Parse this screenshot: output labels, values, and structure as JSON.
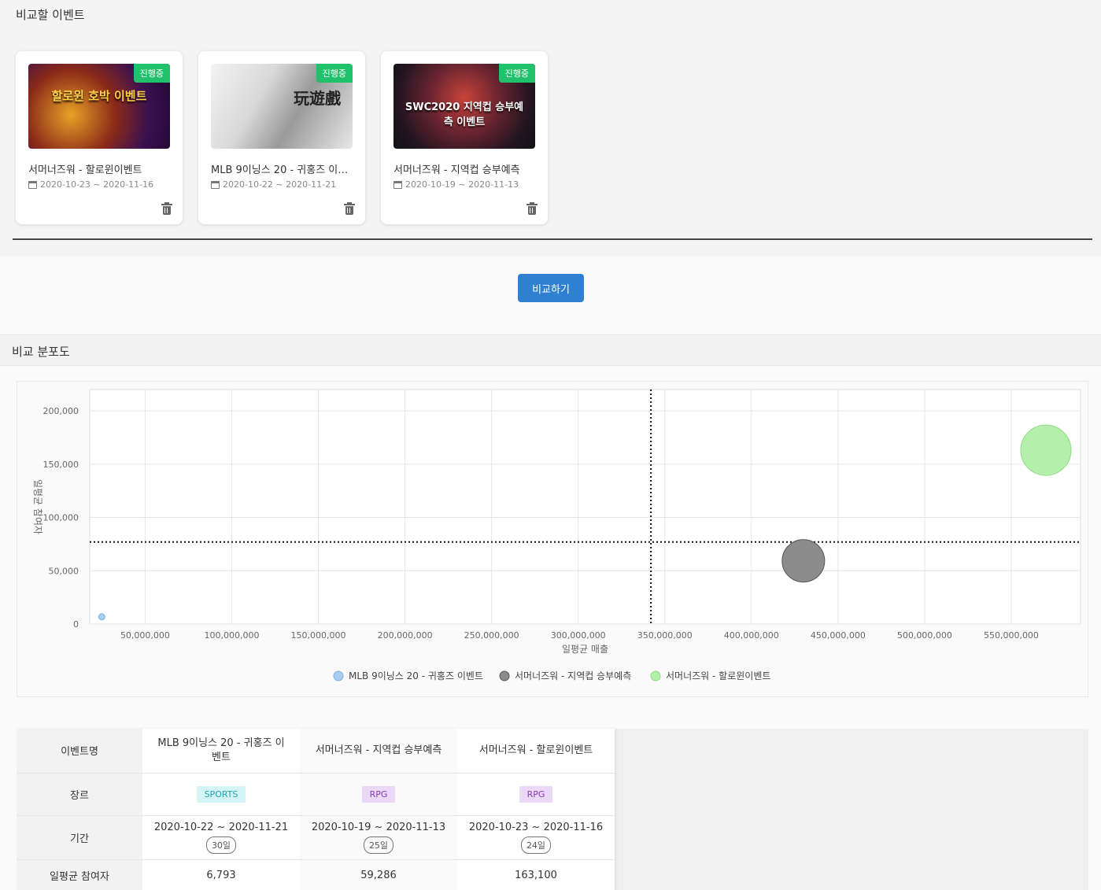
{
  "selection": {
    "title": "비교할 이벤트",
    "cards": [
      {
        "title": "서머너즈워 - 할로윈이벤트",
        "date": "2020-10-23 ~ 2020-11-16",
        "status": "진행중",
        "art_text": "할로윈 호박 이벤트"
      },
      {
        "title": "MLB 9이닝스 20 - 귀홍즈 이벤트",
        "date": "2020-10-22 ~ 2020-11-21",
        "status": "진행중",
        "art_text": "玩遊戲"
      },
      {
        "title": "서머너즈워 - 지역컵 승부예측",
        "date": "2020-10-19 ~ 2020-11-13",
        "status": "진행중",
        "art_text": "SWC2020 지역컵 승부예측 이벤트"
      }
    ]
  },
  "compare_button": "비교하기",
  "scatter": {
    "title": "비교 분포도"
  },
  "chart_data": {
    "type": "scatter",
    "xlabel": "일평균 매출",
    "ylabel": "일평균 참여자",
    "x_ticks": [
      "50,000,000",
      "100,000,000",
      "150,000,000",
      "200,000,000",
      "250,000,000",
      "300,000,000",
      "350,000,000",
      "400,000,000",
      "450,000,000",
      "500,000,000",
      "550,000,000"
    ],
    "y_ticks": [
      "0",
      "50,000",
      "100,000",
      "150,000",
      "200,000"
    ],
    "xlim": [
      18000000,
      590000000
    ],
    "ylim": [
      0,
      220000
    ],
    "mean_x": 342000000,
    "mean_y": 77000,
    "series": [
      {
        "name": "MLB 9이닝스 20 - 귀홍즈 이벤트",
        "x": 25000000,
        "y": 6793,
        "color": "#a9cdf0",
        "stroke": "#7fb2e5",
        "size": 4
      },
      {
        "name": "서머너즈워 - 지역컵 승부예측",
        "x": 430000000,
        "y": 59286,
        "color": "#8c8c8c",
        "stroke": "#555555",
        "size": 27
      },
      {
        "name": "서머너즈워 - 할로윈이벤트",
        "x": 570000000,
        "y": 163100,
        "color": "#b5efac",
        "stroke": "#8ddc7f",
        "size": 32
      }
    ]
  },
  "table": {
    "row_labels": {
      "name": "이벤트명",
      "genre": "장르",
      "period": "기간",
      "avg": "일평균 참여자"
    },
    "columns": [
      {
        "name": "MLB 9이닝스 20 - 귀홍즈 이벤트",
        "genre": "SPORTS",
        "period": "2020-10-22 ~ 2020-11-21",
        "days": "30일",
        "avg": "6,793"
      },
      {
        "name": "서머너즈워 - 지역컵 승부예측",
        "genre": "RPG",
        "period": "2020-10-19 ~ 2020-11-13",
        "days": "25일",
        "avg": "59,286"
      },
      {
        "name": "서머너즈워 - 할로윈이벤트",
        "genre": "RPG",
        "period": "2020-10-23 ~ 2020-11-16",
        "days": "24일",
        "avg": "163,100"
      }
    ],
    "genre_colors": {
      "SPORTS": {
        "bg": "#d4f4f6",
        "fg": "#21a6b0"
      },
      "RPG": {
        "bg": "#ead8f6",
        "fg": "#8a3bbf"
      }
    }
  }
}
